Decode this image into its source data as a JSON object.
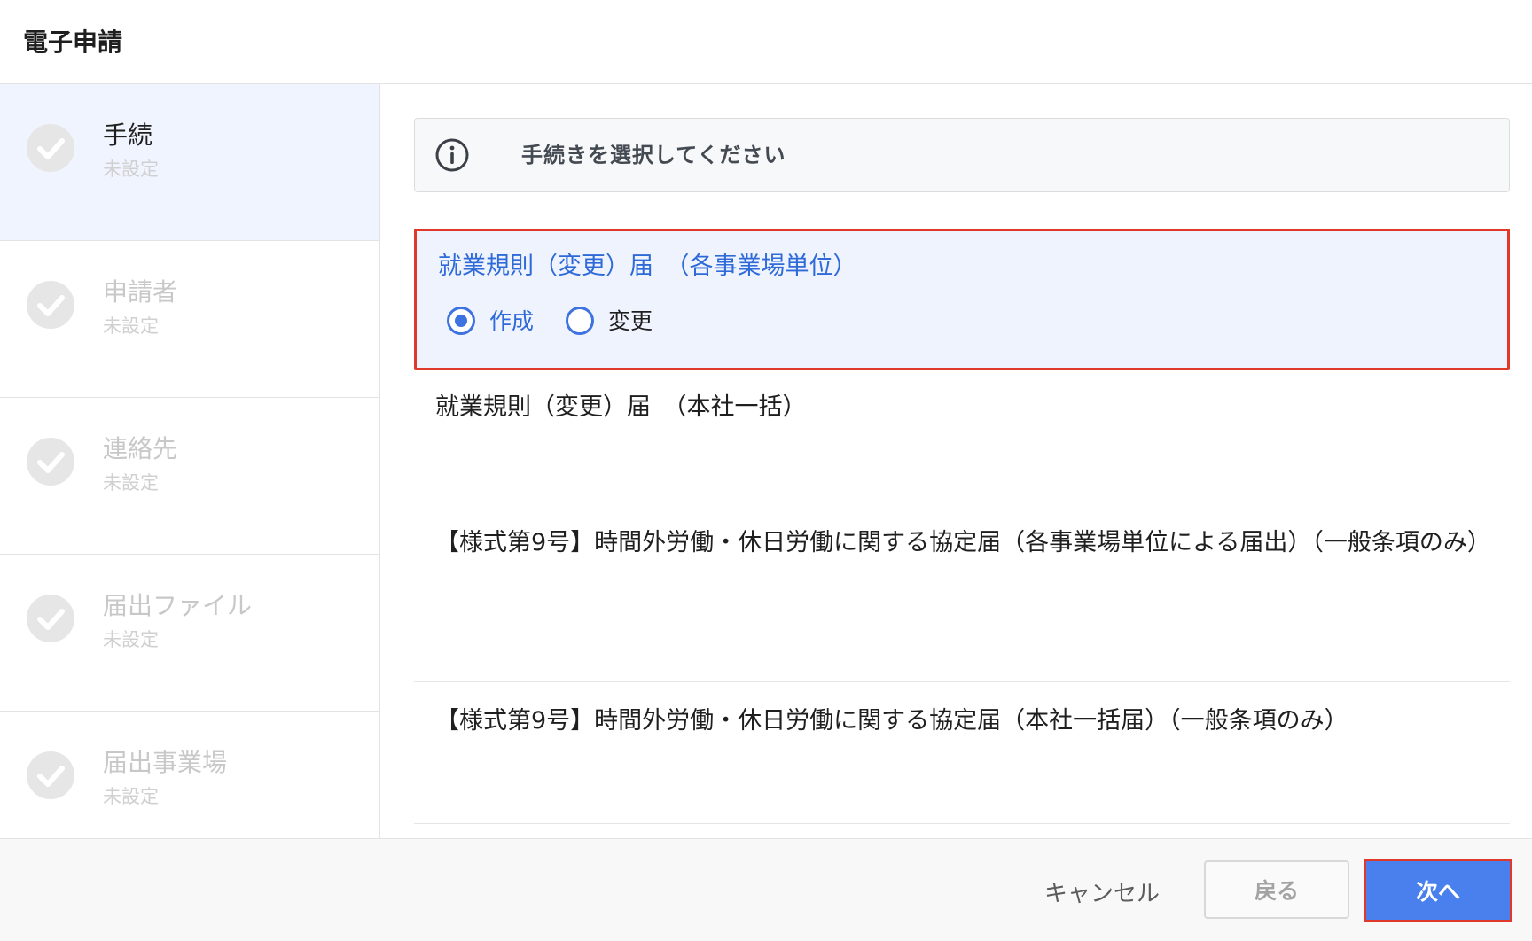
{
  "dialog": {
    "title": "電子申請"
  },
  "steps": [
    {
      "name": "手続",
      "status": "未設定",
      "active": true
    },
    {
      "name": "申請者",
      "status": "未設定",
      "active": false
    },
    {
      "name": "連絡先",
      "status": "未設定",
      "active": false
    },
    {
      "name": "届出ファイル",
      "status": "未設定",
      "active": false
    },
    {
      "name": "届出事業場",
      "status": "未設定",
      "active": false
    }
  ],
  "info": {
    "icon": "info-icon",
    "text": "手続きを選択してください"
  },
  "procedures": [
    {
      "title": "就業規則（変更）届　（各事業場単位）",
      "selected": true,
      "options": [
        {
          "label": "作成",
          "checked": true
        },
        {
          "label": "変更",
          "checked": false
        }
      ]
    },
    {
      "title": "就業規則（変更）届　（本社一括）",
      "selected": false
    },
    {
      "title": "【様式第9号】時間外労働・休日労働に関する協定届（各事業場単位による届出）（一般条項のみ）",
      "selected": false
    },
    {
      "title": "【様式第9号】時間外労働・休日労働に関する協定届（本社一括届）（一般条項のみ）",
      "selected": false
    }
  ],
  "footer": {
    "cancel_label": "キャンセル",
    "back_label": "戻る",
    "next_label": "次へ"
  },
  "colors": {
    "accent": "#4a80ee",
    "selected_text": "#2f6ad9",
    "highlight_border": "#e0392b",
    "selected_bg": "#eff3fd",
    "active_step_bg": "#f0f4fe"
  }
}
